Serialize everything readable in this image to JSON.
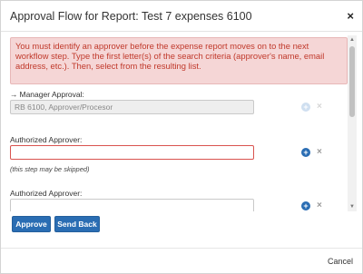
{
  "dialog": {
    "title": "Approval Flow for Report: Test 7 expenses 6100",
    "close_icon": "×"
  },
  "alert": {
    "message": "You must identify an approver before the expense report moves on to the next workflow step. Type the first letter(s) of the search criteria (approver's name, email address, etc.). Then, select from the resulting list."
  },
  "steps": [
    {
      "label": "Manager Approval:",
      "arrow": "→",
      "value": "RB 6100, Approver/Procesor"
    },
    {
      "label": "Authorized Approver:",
      "value": "",
      "note": "(this step may be skipped)"
    },
    {
      "label": "Authorized Approver:",
      "value": ""
    }
  ],
  "buttons": {
    "approve": "Approve",
    "send_back": "Send Back",
    "cancel": "Cancel"
  },
  "icons": {
    "plus": "+",
    "remove": "×",
    "scroll_up": "▲",
    "scroll_down": "▼"
  },
  "colors": {
    "primary": "#2a6db3",
    "alert_bg": "#f5d6d6",
    "alert_text": "#c0392b",
    "error_border": "#d9534f"
  }
}
